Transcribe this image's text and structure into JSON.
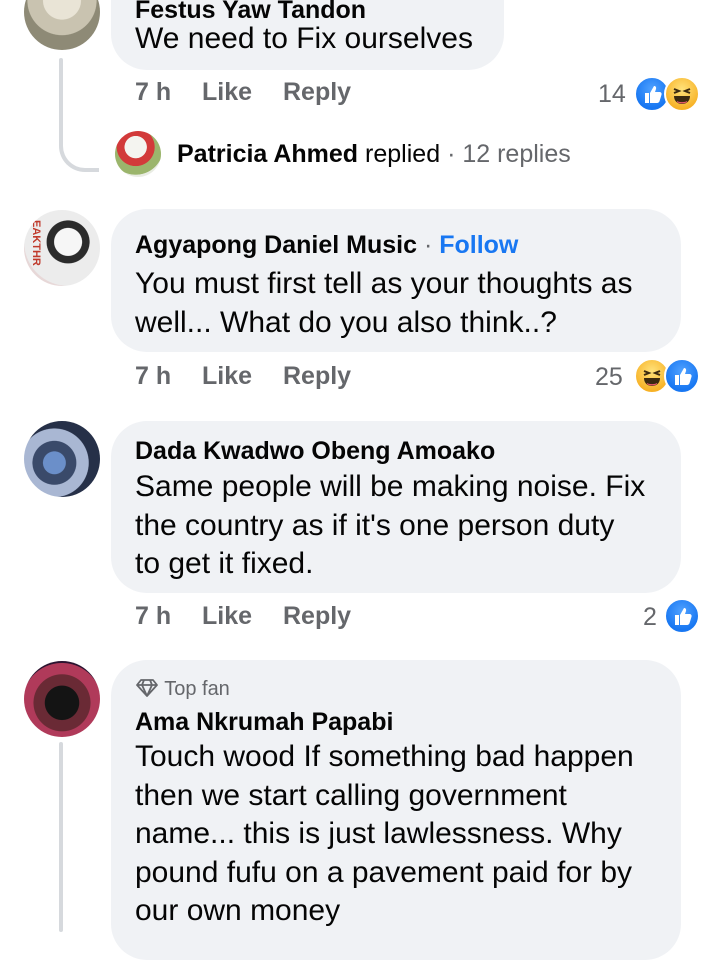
{
  "comments": [
    {
      "author": "Festus Yaw Tandon",
      "text": "We need to Fix ourselves",
      "time": "7 h",
      "like_label": "Like",
      "reply_label": "Reply",
      "reaction_count": "14",
      "reactions": [
        "like-icon",
        "haha-icon"
      ],
      "replied": {
        "name": "Patricia Ahmed",
        "verb": "replied",
        "count": "· 12 replies"
      }
    },
    {
      "author": "Agyapong Daniel Music",
      "follow": "Follow",
      "text_lines": [
        "You must first tell as your thoughts as",
        "well... What do you also think..?"
      ],
      "time": "7 h",
      "like_label": "Like",
      "reply_label": "Reply",
      "reaction_count": "25",
      "reactions": [
        "haha-icon",
        "like-icon"
      ]
    },
    {
      "author": "Dada Kwadwo Obeng Amoako",
      "text_lines": [
        "Same people will be making noise. Fix",
        "the country as if it's one person duty",
        "to get it fixed."
      ],
      "time": "7 h",
      "like_label": "Like",
      "reply_label": "Reply",
      "reaction_count": "2",
      "reactions": [
        "like-icon"
      ]
    },
    {
      "badge": "Top fan",
      "badge_icon": "diamond-icon",
      "author": "Ama Nkrumah Papabi",
      "text_lines": [
        "Touch wood If something bad happen",
        "then we start calling government",
        "name... this is just lawlessness.  Why",
        "pound fufu on a pavement paid for by",
        "our own money"
      ]
    }
  ],
  "colors": {
    "bubble": "#f0f2f5",
    "meta": "#65676b",
    "link": "#1877f2",
    "thread": "#d6d9dd"
  }
}
